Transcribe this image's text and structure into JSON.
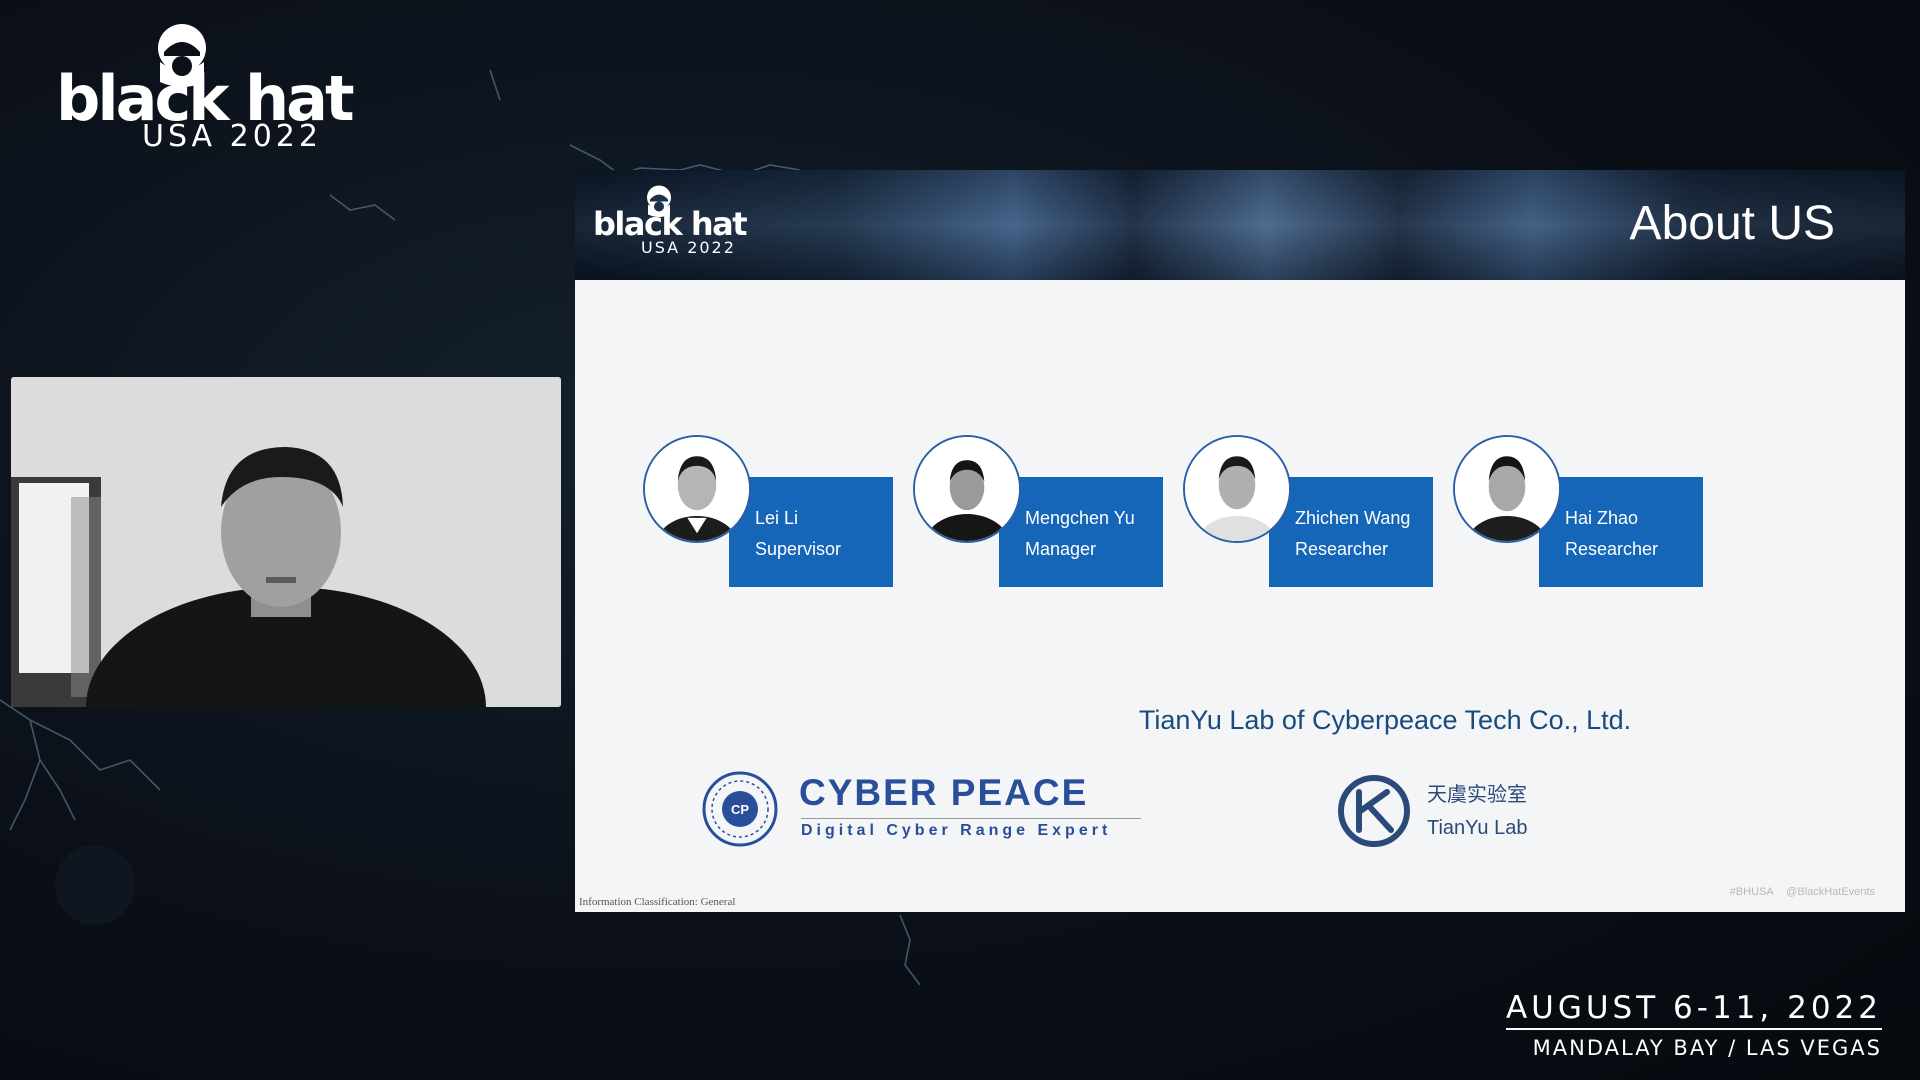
{
  "event": {
    "brand": "black hat",
    "edition": "USA 2022",
    "dates": "AUGUST 6-11, 2022",
    "venue": "MANDALAY BAY / LAS VEGAS"
  },
  "slide": {
    "logo_brand": "black hat",
    "logo_edition": "USA 2022",
    "title": "About US",
    "team": [
      {
        "name": "Lei Li",
        "role": "Supervisor"
      },
      {
        "name": "Mengchen Yu",
        "role": "Manager"
      },
      {
        "name": "Zhichen Wang",
        "role": "Researcher"
      },
      {
        "name": "Hai Zhao",
        "role": "Researcher"
      }
    ],
    "lab_name": "TianYu Lab of Cyberpeace Tech Co., Ltd.",
    "cyberpeace_logo": {
      "name": "CYBER PEACE",
      "tagline": "Digital Cyber Range Expert",
      "badge": "CP"
    },
    "tianyu_logo": {
      "name_cn": "天虞实验室",
      "name_en": "TianYu Lab"
    },
    "classification": "Information Classification: General",
    "hashtags": "#BHUSA @BlackHatEvents"
  },
  "colors": {
    "background": "#0b1018",
    "slide_card_blue": "#1565b8",
    "lab_text": "#1a4a7e",
    "cyberpeace_blue": "#2a4f9a"
  },
  "icons": {
    "event_logo": "black-hat-icon",
    "cyberpeace": "cyberpeace-emblem-icon",
    "tianyu": "tianyu-k-icon"
  }
}
